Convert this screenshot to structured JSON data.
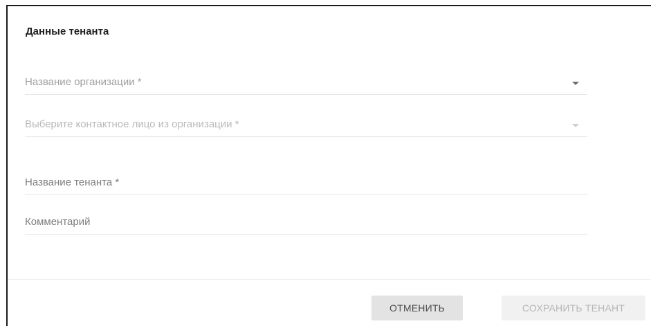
{
  "dialog": {
    "title": "Данные тенанта"
  },
  "form": {
    "organization": {
      "label": "Название организации *",
      "value": ""
    },
    "contact": {
      "label": "Выберите контактное лицо из организации *",
      "value": "",
      "disabled": true
    },
    "tenant_name": {
      "label": "Название тенанта *",
      "value": ""
    },
    "comment": {
      "label": "Комментарий",
      "value": ""
    }
  },
  "footer": {
    "cancel_label": "ОТМЕНИТЬ",
    "save_label": "СОХРАНИТЬ ТЕНАНТ",
    "save_disabled": true
  },
  "icons": {
    "organization_dropdown": "chevron-down-icon",
    "contact_dropdown": "chevron-down-icon"
  }
}
